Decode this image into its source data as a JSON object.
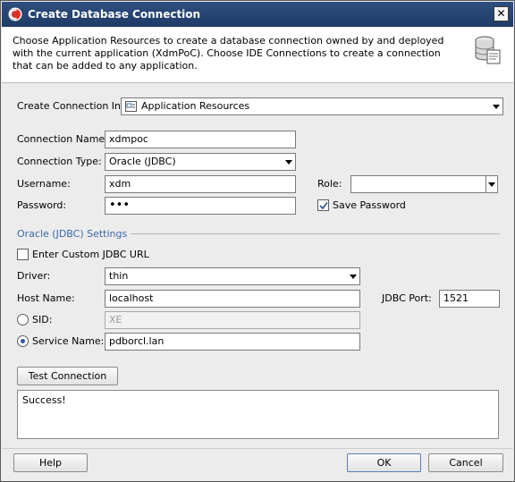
{
  "window": {
    "title": "Create Database Connection",
    "close_glyph": "✕"
  },
  "banner": {
    "text": "Choose Application Resources to create a database connection owned by and deployed with the current application (XdmPoC). Choose IDE Connections to create a connection that can be added to any application.",
    "icon": "database-icon"
  },
  "form": {
    "create_in": {
      "label": "Create Connection In:",
      "value": "Application Resources"
    },
    "connection_name": {
      "label": "Connection Name:",
      "value": "xdmpoc"
    },
    "connection_type": {
      "label": "Connection Type:",
      "value": "Oracle (JDBC)"
    },
    "username": {
      "label": "Username:",
      "value": "xdm"
    },
    "password": {
      "label": "Password:",
      "value": "•••"
    },
    "role": {
      "label": "Role:",
      "value": ""
    },
    "save_password": {
      "label": "Save Password",
      "checked": true
    }
  },
  "oracle_settings": {
    "section_title": "Oracle (JDBC) Settings",
    "custom_url": {
      "label": "Enter Custom JDBC URL",
      "checked": false
    },
    "driver": {
      "label": "Driver:",
      "value": "thin"
    },
    "host_name": {
      "label": "Host Name:",
      "value": "localhost"
    },
    "jdbc_port": {
      "label": "JDBC Port:",
      "value": "1521"
    },
    "sid": {
      "label": "SID:",
      "value": "XE",
      "selected": false
    },
    "service_name": {
      "label": "Service Name:",
      "value": "pdborcl.lan",
      "selected": true
    }
  },
  "test": {
    "button_label": "Test Connection",
    "result_text": "Success!"
  },
  "footer": {
    "help_label": "Help",
    "ok_label": "OK",
    "cancel_label": "Cancel"
  }
}
